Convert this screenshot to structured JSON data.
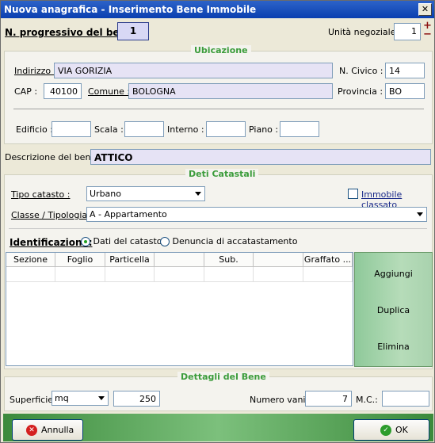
{
  "window": {
    "title": "Nuova anagrafica - Inserimento Bene Immobile",
    "close_label": "✕"
  },
  "header": {
    "progressivo_label": "N. progressivo del bene:",
    "progressivo_value": "1",
    "unita_label": "Unità negoziale:",
    "unita_value": "1",
    "plus": "+",
    "minus": "−"
  },
  "ubicazione": {
    "legend": "Ubicazione",
    "indirizzo_label": "Indirizzo :",
    "indirizzo_value": "VIA GORIZIA",
    "civico_label": "N. Civico :",
    "civico_value": "14",
    "cap_label": "CAP :",
    "cap_value": "40100",
    "comune_label": "Comune :",
    "comune_value": "BOLOGNA",
    "provincia_label": "Provincia :",
    "provincia_value": "BO",
    "edificio_label": "Edificio :",
    "scala_label": "Scala :",
    "interno_label": "Interno :",
    "piano_label": "Piano :"
  },
  "descrizione": {
    "label": "Descrizione del bene:",
    "value": "ATTICO"
  },
  "catasto": {
    "legend": "Deti Catastali",
    "tipo_label": "Tipo catasto :",
    "tipo_value": "Urbano",
    "classato_label": "Immobile classato",
    "classe_label": "Classe / Tipologia :",
    "classe_value": "A - Appartamento",
    "identificazione_label": "Identificazione:",
    "radio1_label": "Dati del catasto",
    "radio2_label": "Denuncia di accatastamento",
    "columns": [
      "Sezione",
      "Foglio",
      "Particella",
      "",
      "Sub.",
      "",
      "Graffato ..."
    ],
    "aggiungi": "Aggiungi",
    "duplica": "Duplica",
    "elimina": "Elimina"
  },
  "dettagli": {
    "legend": "Dettagli del Bene",
    "superficie_label": "Superficie:",
    "unit_value": "mq",
    "superficie_value": "250",
    "vani_label": "Numero vani:",
    "vani_value": "7",
    "mc_label": "M.C.:"
  },
  "footer": {
    "annulla": "Annulla",
    "ok": "OK"
  },
  "colors": {
    "accent": "#3b9c3b",
    "titlebar": "#0a3fb0"
  }
}
